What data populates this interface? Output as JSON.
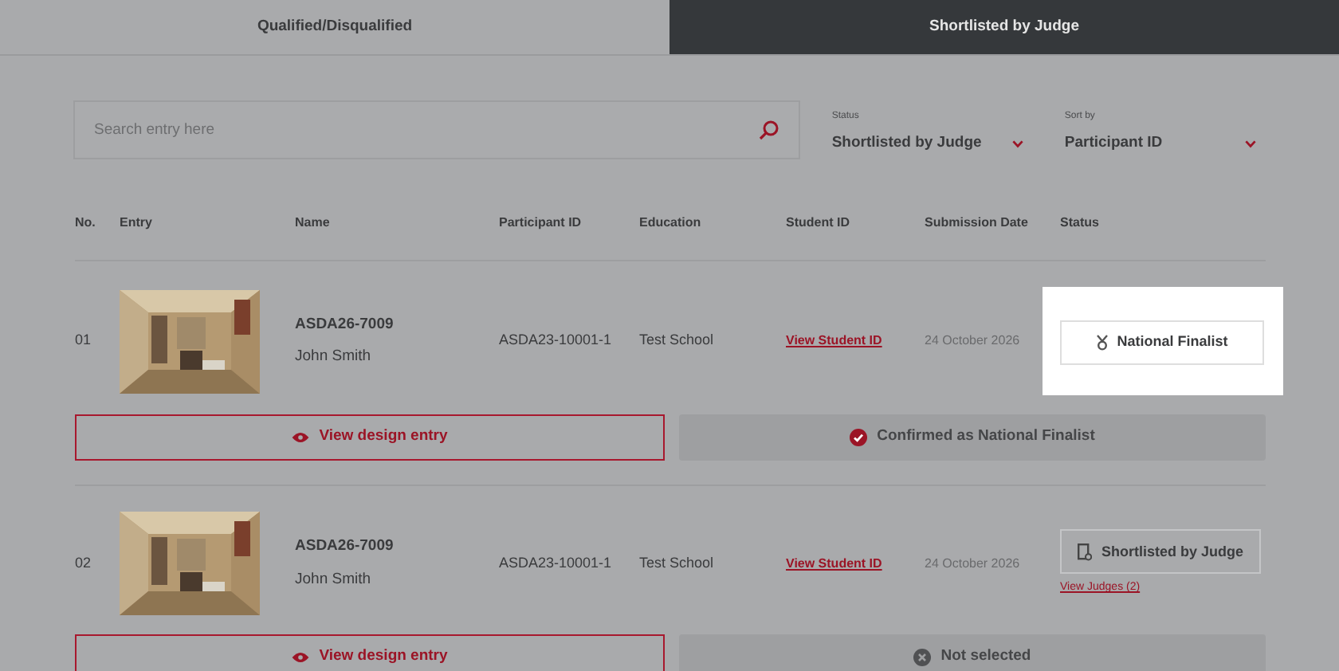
{
  "tabs": [
    {
      "label": "Qualified/Disqualified",
      "selected": false
    },
    {
      "label": "Shortlisted by Judge",
      "selected": true
    }
  ],
  "search": {
    "placeholder": "Search entry here"
  },
  "filters": [
    {
      "label": "Status",
      "value": "Shortlisted by Judge"
    },
    {
      "label": "Sort by",
      "value": "Participant ID"
    }
  ],
  "table": {
    "columns": [
      "No.",
      "Entry",
      "Name",
      "Participant ID",
      "Education",
      "Student ID",
      "Submission Date",
      "Status"
    ],
    "rows": [
      {
        "no": "01",
        "entry_code": "ASDA26-7009",
        "name": "John Smith",
        "participant_id": "ASDA23-10001-1",
        "education": "Test School",
        "student_id": "View Student ID",
        "submission_date": "24 October 2026",
        "status": {
          "kind": "finalist",
          "label": "National Finalist",
          "highlighted": true
        },
        "view_button": "View design entry",
        "result": {
          "kind": "confirmed",
          "label": "Confirmed as National Finalist"
        }
      },
      {
        "no": "02",
        "entry_code": "ASDA26-7009",
        "name": "John Smith",
        "participant_id": "ASDA23-10001-1",
        "education": "Test School",
        "student_id": "View Student ID",
        "submission_date": "24 October 2026",
        "status": {
          "kind": "shortlisted",
          "label": "Shortlisted by Judge",
          "highlighted": false,
          "link": "View Judges (2)"
        },
        "view_button": "View design entry",
        "result": {
          "kind": "not-selected",
          "label": "Not selected"
        }
      }
    ]
  }
}
